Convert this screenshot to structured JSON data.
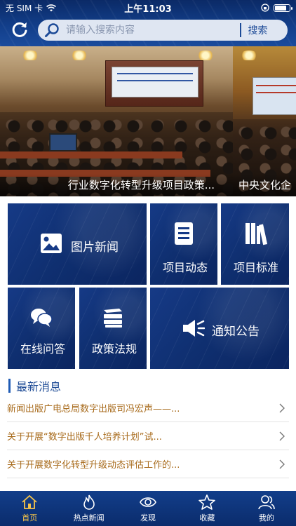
{
  "status_bar": {
    "carrier": "无 SIM 卡",
    "time": "上午11:03"
  },
  "search": {
    "placeholder": "请输入搜索内容",
    "button": "搜索"
  },
  "banner": {
    "caption_main": "行业数字化转型升级项目政策...",
    "caption_next": "中央文化企"
  },
  "tiles": {
    "picture_news": "图片新闻",
    "project_news": "项目动态",
    "project_standard": "项目标准",
    "online_qa": "在线问答",
    "policy": "政策法规",
    "notice": "通知公告"
  },
  "news": {
    "title": "最新消息",
    "items": [
      "新闻出版广电总局数字出版司冯宏声——...",
      "关于开展“数字出版千人培养计划”试...",
      "关于开展数字化转型升级动态评估工作的..."
    ]
  },
  "tabbar": {
    "items": [
      "首页",
      "热点新闻",
      "发现",
      "收藏",
      "我的"
    ],
    "active": "首页"
  },
  "colors": {
    "brand_blue": "#123e8a",
    "tile_blue": "#163a86",
    "news_text": "#a86b1c",
    "active_tab": "#f2c24a"
  }
}
